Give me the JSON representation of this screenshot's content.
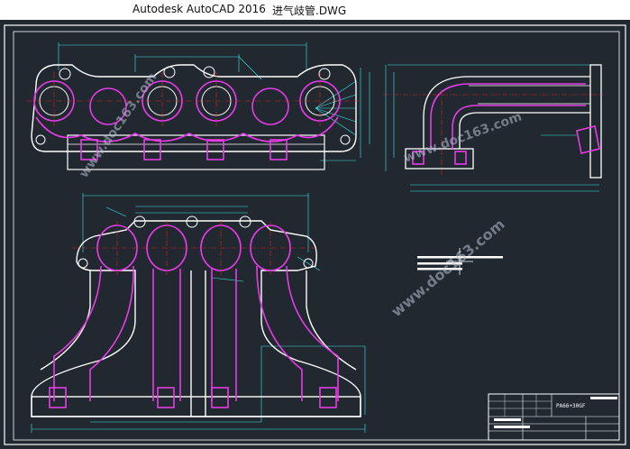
{
  "titlebar": {
    "app_title": "Autodesk AutoCAD 2016",
    "file_title": "进气歧管.DWG"
  },
  "watermark": {
    "text": "www.doc163.com"
  },
  "title_block": {
    "material": "PA66+30GF"
  },
  "colors": {
    "canvas_bg": "#212830",
    "frame": "#ffffff",
    "outline": "#ffffff",
    "magenta": "#e63ce6",
    "cyan": "#3ce8e8",
    "red": "#e02020",
    "yellow": "#f0e040"
  },
  "tools": {
    "cursor_icon": "crosshair-icon"
  }
}
